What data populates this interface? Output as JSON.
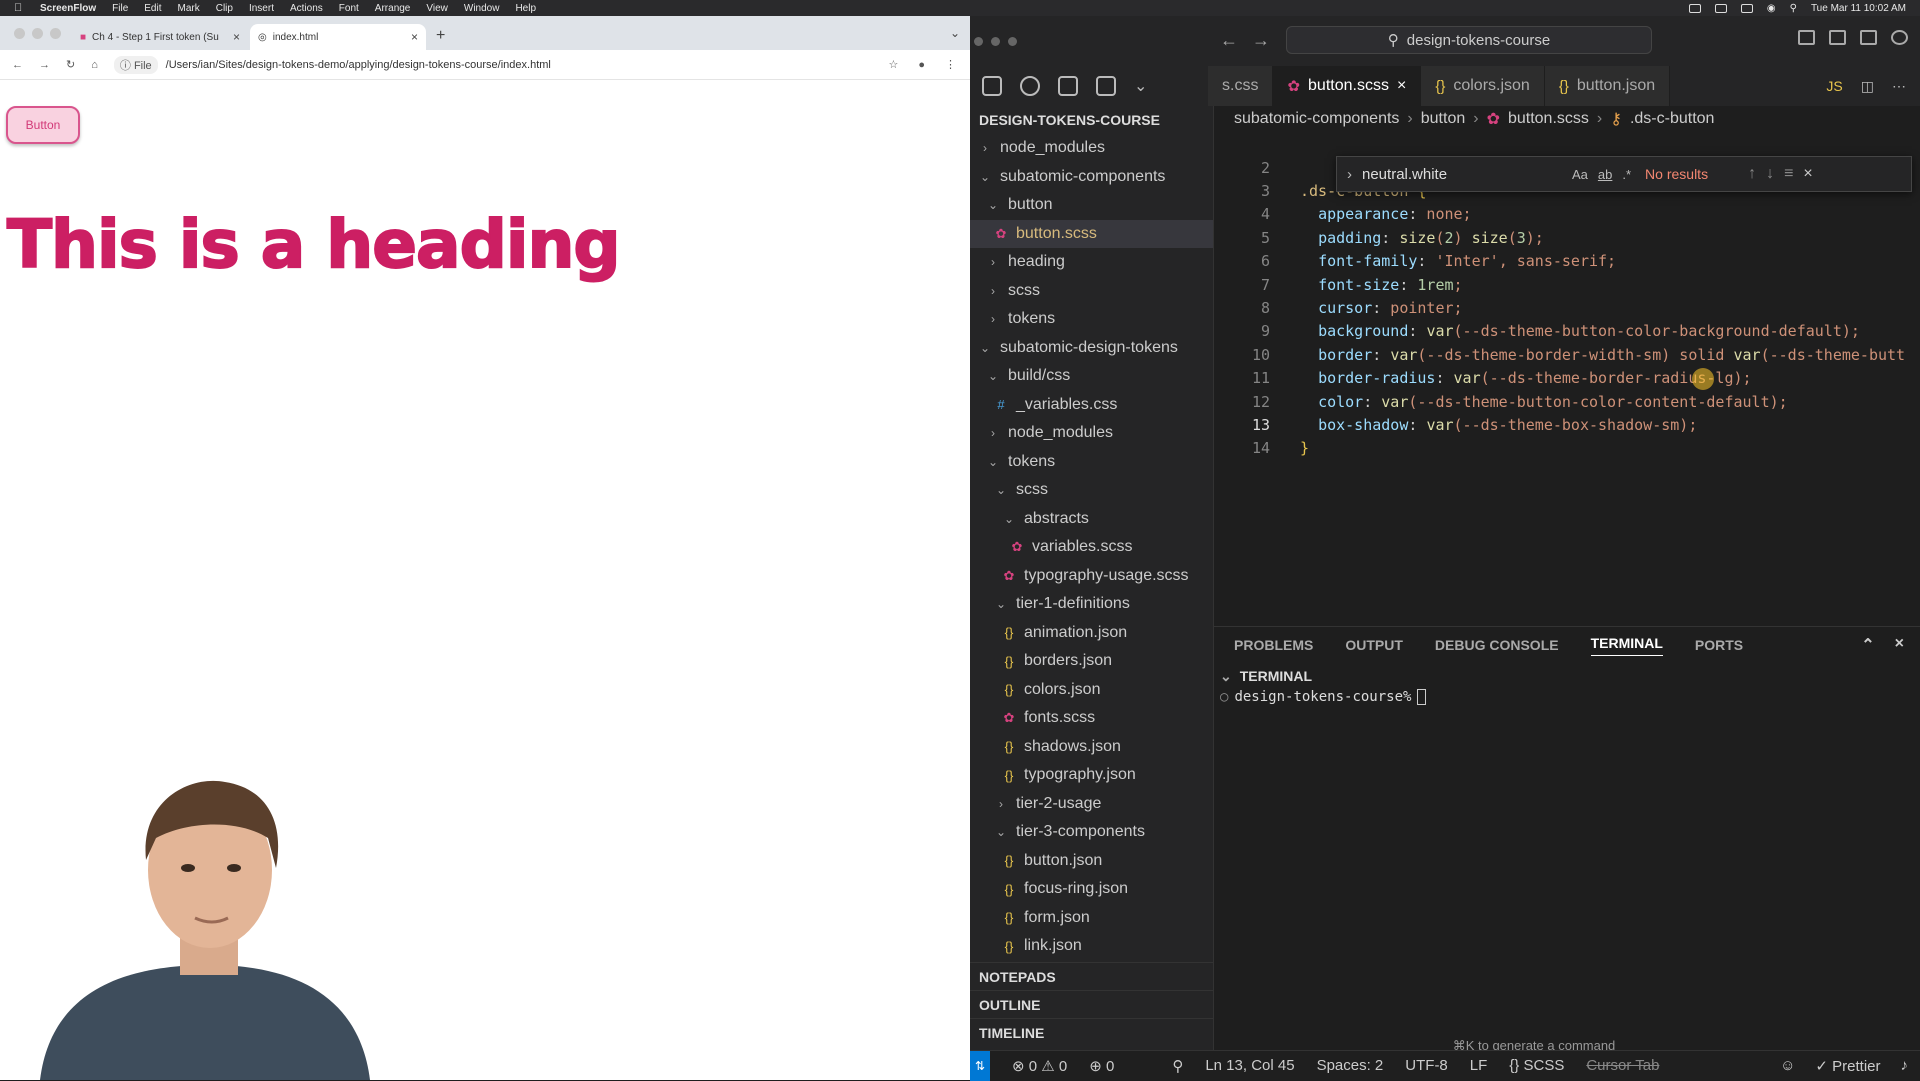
{
  "menubar": {
    "app": "ScreenFlow",
    "items": [
      "File",
      "Edit",
      "Mark",
      "Clip",
      "Insert",
      "Actions",
      "Font",
      "Arrange",
      "View",
      "Window",
      "Help"
    ],
    "datetime": "Tue Mar 11  10:02 AM"
  },
  "browser": {
    "tabs": [
      {
        "title": "Ch 4 - Step 1 First token (Su"
      },
      {
        "title": "index.html"
      }
    ],
    "address": {
      "scheme_label": "File",
      "url": "/Users/ian/Sites/design-tokens-demo/applying/design-tokens-course/index.html"
    },
    "page": {
      "button_label": "Button",
      "heading": "This is a heading"
    }
  },
  "editor": {
    "command_center": "design-tokens-course",
    "tabs": [
      {
        "label": "s.css",
        "kind": "css",
        "active": false
      },
      {
        "label": "button.scss",
        "kind": "scss",
        "active": true
      },
      {
        "label": "colors.json",
        "kind": "json",
        "active": false
      },
      {
        "label": "button.json",
        "kind": "json",
        "active": false
      }
    ],
    "tab_right_label": "JS",
    "explorer": {
      "title": "DESIGN-TOKENS-COURSE",
      "items": [
        {
          "label": "node_modules",
          "type": "folder",
          "open": false,
          "depth": 0
        },
        {
          "label": "subatomic-components",
          "type": "folder",
          "open": true,
          "depth": 0
        },
        {
          "label": "button",
          "type": "folder",
          "open": true,
          "depth": 1
        },
        {
          "label": "button.scss",
          "type": "scss",
          "depth": 2,
          "selected": true
        },
        {
          "label": "heading",
          "type": "folder",
          "open": false,
          "depth": 1
        },
        {
          "label": "scss",
          "type": "folder",
          "open": false,
          "depth": 1
        },
        {
          "label": "tokens",
          "type": "folder",
          "open": false,
          "depth": 1
        },
        {
          "label": "subatomic-design-tokens",
          "type": "folder",
          "open": true,
          "depth": 0
        },
        {
          "label": "build/css",
          "type": "folder",
          "open": true,
          "depth": 1
        },
        {
          "label": "_variables.css",
          "type": "css",
          "depth": 2
        },
        {
          "label": "node_modules",
          "type": "folder",
          "open": false,
          "depth": 1
        },
        {
          "label": "tokens",
          "type": "folder",
          "open": true,
          "depth": 1
        },
        {
          "label": "scss",
          "type": "folder",
          "open": true,
          "depth": 2
        },
        {
          "label": "abstracts",
          "type": "folder",
          "open": true,
          "depth": 3
        },
        {
          "label": "variables.scss",
          "type": "scss",
          "depth": 4
        },
        {
          "label": "typography-usage.scss",
          "type": "scss",
          "depth": 3
        },
        {
          "label": "tier-1-definitions",
          "type": "folder",
          "open": true,
          "depth": 2
        },
        {
          "label": "animation.json",
          "type": "json",
          "depth": 3
        },
        {
          "label": "borders.json",
          "type": "json",
          "depth": 3
        },
        {
          "label": "colors.json",
          "type": "json",
          "depth": 3
        },
        {
          "label": "fonts.scss",
          "type": "scss",
          "depth": 3
        },
        {
          "label": "shadows.json",
          "type": "json",
          "depth": 3
        },
        {
          "label": "typography.json",
          "type": "json",
          "depth": 3
        },
        {
          "label": "tier-2-usage",
          "type": "folder",
          "open": false,
          "depth": 2
        },
        {
          "label": "tier-3-components",
          "type": "folder",
          "open": true,
          "depth": 2
        },
        {
          "label": "button.json",
          "type": "json",
          "depth": 3
        },
        {
          "label": "focus-ring.json",
          "type": "json",
          "depth": 3
        },
        {
          "label": "form.json",
          "type": "json",
          "depth": 3
        },
        {
          "label": "link.json",
          "type": "json",
          "depth": 3
        }
      ],
      "sections": [
        "NOTEPADS",
        "OUTLINE",
        "TIMELINE"
      ]
    },
    "breadcrumbs": [
      "subatomic-components",
      "button",
      "button.scss",
      ".ds-c-button"
    ],
    "find": {
      "query": "neutral.white",
      "opt_case": "Aa",
      "opt_word": "ab",
      "opt_regex": ".*",
      "result": "No results"
    },
    "code_lines": [
      {
        "num": "2",
        "text": ""
      },
      {
        "num": "3",
        "text": ".ds-c-button {"
      },
      {
        "num": "4",
        "text": "  appearance: none;"
      },
      {
        "num": "5",
        "text": "  padding: size(2) size(3);"
      },
      {
        "num": "6",
        "text": "  font-family: 'Inter', sans-serif;"
      },
      {
        "num": "7",
        "text": "  font-size: 1rem;"
      },
      {
        "num": "8",
        "text": "  cursor: pointer;"
      },
      {
        "num": "9",
        "text": "  background: var(--ds-theme-button-color-background-default);"
      },
      {
        "num": "10",
        "text": "  border: var(--ds-theme-border-width-sm) solid var(--ds-theme-butt"
      },
      {
        "num": "11",
        "text": "  border-radius: var(--ds-theme-border-radius-lg);"
      },
      {
        "num": "12",
        "text": "  color: var(--ds-theme-button-color-content-default);"
      },
      {
        "num": "13",
        "text": "  box-shadow: var(--ds-theme-box-shadow-sm);"
      },
      {
        "num": "14",
        "text": "}"
      }
    ],
    "current_line": "13",
    "panel": {
      "tabs": [
        "PROBLEMS",
        "OUTPUT",
        "DEBUG CONSOLE",
        "TERMINAL",
        "PORTS"
      ],
      "active_tab": "TERMINAL",
      "terminal_header": "TERMINAL",
      "prompt": "design-tokens-course%",
      "hint": "⌘K to generate a command"
    },
    "status": {
      "errors": "0",
      "warnings": "0",
      "ports": "0",
      "position": "Ln 13, Col 45",
      "spaces": "Spaces: 2",
      "encoding": "UTF-8",
      "eol": "LF",
      "language": "SCSS",
      "cursor_tab": "Cursor Tab",
      "formatter": "Prettier"
    }
  },
  "colors": {
    "heading": "#cc1f63",
    "button_border": "#d9558d",
    "accent_blue": "#0078d4"
  }
}
